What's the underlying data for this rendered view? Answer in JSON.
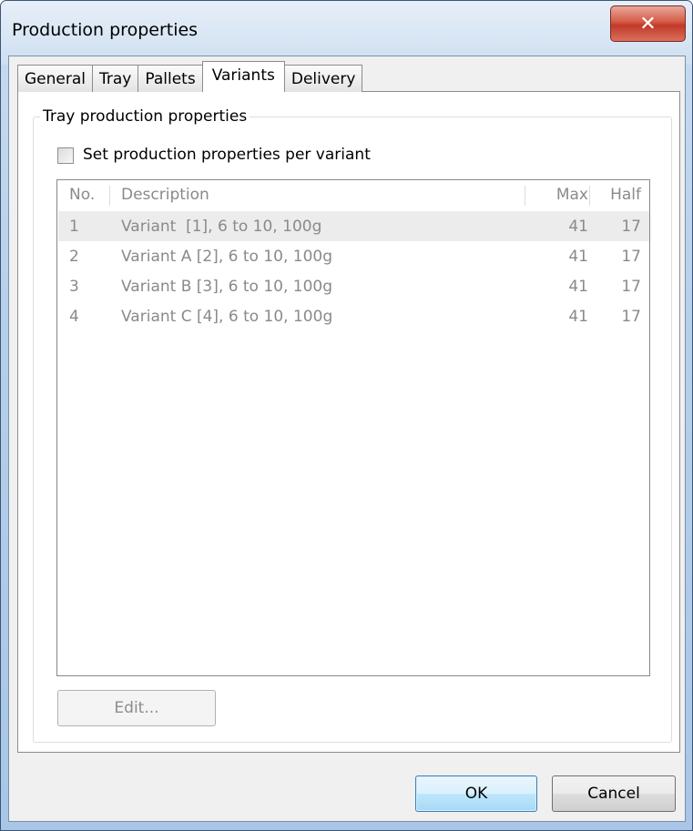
{
  "window": {
    "title": "Production properties",
    "close_glyph": "✕"
  },
  "tabs": [
    {
      "label": "General",
      "active": false
    },
    {
      "label": "Tray",
      "active": false
    },
    {
      "label": "Pallets",
      "active": false
    },
    {
      "label": "Variants",
      "active": true
    },
    {
      "label": "Delivery",
      "active": false
    }
  ],
  "group": {
    "label": "Tray production properties",
    "checkbox_label": "Set production properties per variant",
    "checkbox_checked": false
  },
  "list": {
    "columns": [
      "No.",
      "Description",
      "Max",
      "Half"
    ],
    "rows": [
      {
        "no": "1",
        "description": "Variant  [1], 6 to 10, 100g",
        "max": "41",
        "half": "17",
        "selected": true
      },
      {
        "no": "2",
        "description": "Variant A [2], 6 to 10, 100g",
        "max": "41",
        "half": "17",
        "selected": false
      },
      {
        "no": "3",
        "description": "Variant B [3], 6 to 10, 100g",
        "max": "41",
        "half": "17",
        "selected": false
      },
      {
        "no": "4",
        "description": "Variant C [4], 6 to 10, 100g",
        "max": "41",
        "half": "17",
        "selected": false
      }
    ]
  },
  "buttons": {
    "edit": "Edit...",
    "ok": "OK",
    "cancel": "Cancel"
  }
}
